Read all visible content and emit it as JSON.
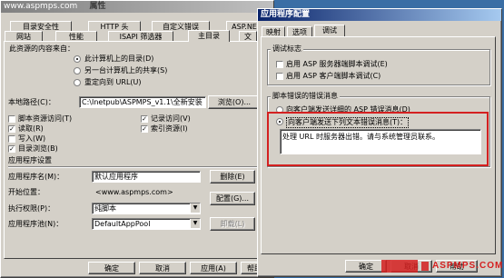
{
  "bg_window": {
    "watermark": "www.aspmps.com",
    "title": "属性",
    "tabs_row1": [
      "目录安全性",
      "HTTP 头",
      "自定义错误",
      "ASP.NE"
    ],
    "tabs_row2": [
      "网站",
      "性能",
      "ISAPI 筛选器",
      "主目录",
      "文"
    ],
    "source_label": "此资源的内容来自：",
    "source_options": [
      "此计算机上的目录(D)",
      "另一台计算机上的共享(S)",
      "重定向到 URL(U)"
    ],
    "local_path_label": "本地路径(C)：",
    "local_path_value": "C:\\Inetpub\\ASPMPS_v1.1\\全新安装",
    "browse_label": "浏览(O)...",
    "checks_left": [
      "脚本资源访问(T)",
      "读取(R)",
      "写入(W)",
      "目录浏览(B)"
    ],
    "checks_left_state": [
      false,
      true,
      false,
      true
    ],
    "checks_right": [
      "记录访问(V)",
      "索引资源(I)"
    ],
    "checks_right_state": [
      true,
      true
    ],
    "app_settings_label": "应用程序设置",
    "app_name_label": "应用程序名(M)：",
    "app_name_value": "默认应用程序",
    "remove_label": "删除(E)",
    "start_label": "开始位置：",
    "start_value": "<www.aspmps.com>",
    "config_label": "配置(G)...",
    "exec_label": "执行权限(P)：",
    "exec_value": "纯脚本",
    "pool_label": "应用程序池(N)：",
    "pool_value": "DefaultAppPool",
    "unload_label": "卸载(L)",
    "ok_label": "确定",
    "cancel_label": "取消",
    "apply_label": "应用(A)",
    "help_label": "帮助"
  },
  "fg_window": {
    "title": "应用程序配置",
    "tabs": [
      "映射",
      "选项",
      "调试"
    ],
    "debug_group": "调试标志",
    "debug_checks": [
      "启用 ASP 服务器端脚本调试(E)",
      "启用 ASP 客户端脚本调试(C)"
    ],
    "error_group": "脚本错误的错误消息",
    "error_option1": "向客户端发送详细的 ASP 错误消息(D)",
    "error_option2": "向客户端发送下列文本错误消息(T)：",
    "error_text": "处理 URL 时服务器出错。请与系统管理员联系。",
    "ok_label": "确定",
    "cancel_label": "取消",
    "help_label": "帮助",
    "logo_text": "ASPMPS.COM"
  }
}
